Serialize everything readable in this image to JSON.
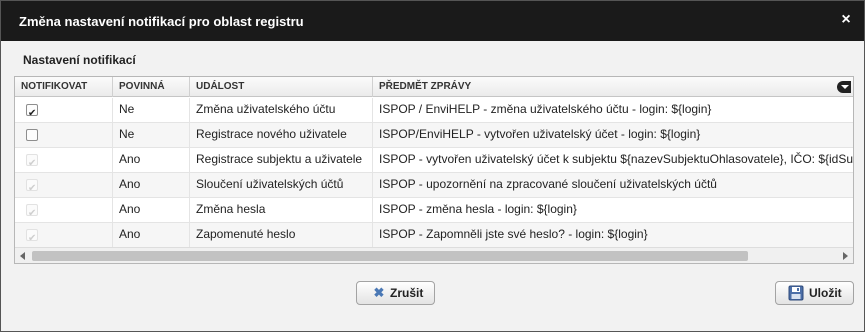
{
  "dialog": {
    "title": "Změna nastavení notifikací pro oblast registru",
    "close_label": "×"
  },
  "section_title": "Nastavení notifikací",
  "columns": [
    "NOTIFIKOVAT",
    "POVINNÁ",
    "UDÁLOST",
    "PŘEDMĚT ZPRÁVY"
  ],
  "rows": [
    {
      "notify": true,
      "notify_disabled": false,
      "required": "Ne",
      "event": "Změna uživatelského účtu",
      "subject": "ISPOP / EnviHELP - změna uživatelského účtu - login: ${login}"
    },
    {
      "notify": false,
      "notify_disabled": false,
      "required": "Ne",
      "event": "Registrace nového uživatele",
      "subject": "ISPOP/EnviHELP - vytvořen uživatelský účet - login: ${login}"
    },
    {
      "notify": true,
      "notify_disabled": true,
      "required": "Ano",
      "event": "Registrace subjektu a uživatele",
      "subject": "ISPOP - vytvořen uživatelský účet k subjektu ${nazevSubjektuOhlasovatele}, IČO: ${idSu"
    },
    {
      "notify": true,
      "notify_disabled": true,
      "required": "Ano",
      "event": "Sloučení uživatelských účtů",
      "subject": "ISPOP - upozornění na zpracované sloučení uživatelských účtů"
    },
    {
      "notify": true,
      "notify_disabled": true,
      "required": "Ano",
      "event": "Změna hesla",
      "subject": "ISPOP - změna hesla - login: ${login}"
    },
    {
      "notify": true,
      "notify_disabled": true,
      "required": "Ano",
      "event": "Zapomenuté heslo",
      "subject": "ISPOP - Zapomněli jste své heslo? - login: ${login}"
    }
  ],
  "buttons": {
    "cancel_label": "Zrušit",
    "cancel_icon": "x-icon",
    "save_label": "Uložit",
    "save_icon": "floppy-disk-icon"
  },
  "colors": {
    "titlebar": "#1a1a1a",
    "cancel_icon": "#4a78b5"
  }
}
